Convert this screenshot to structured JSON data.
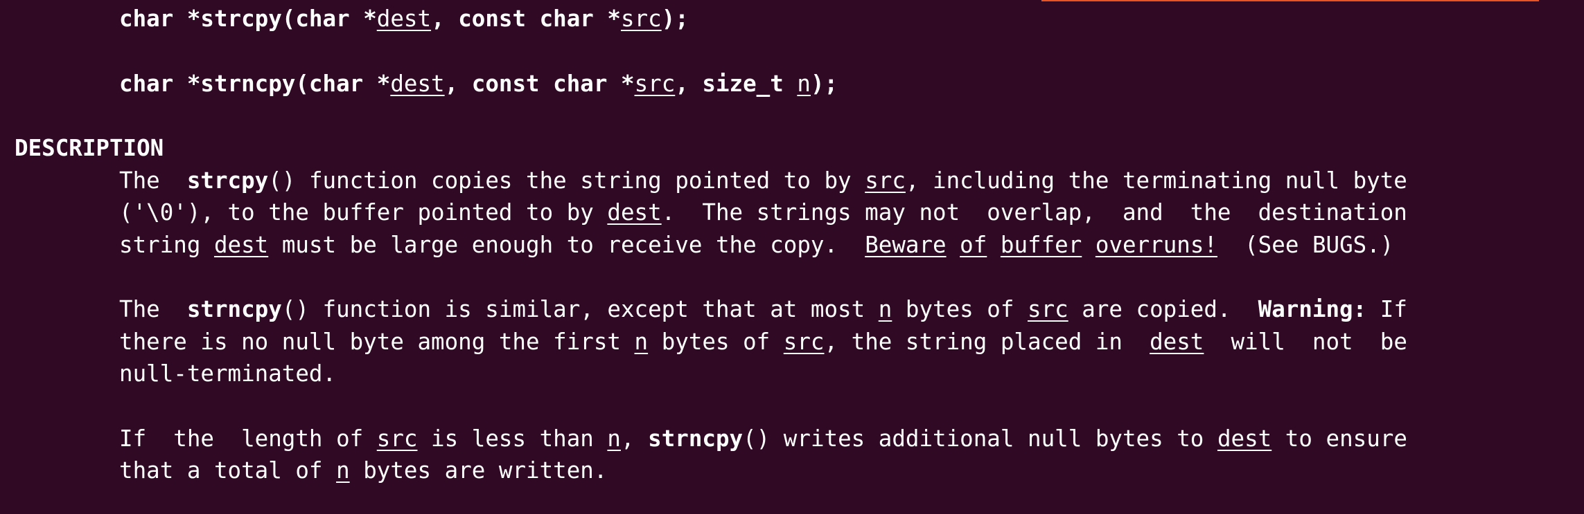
{
  "terminal": {
    "accent_color": "#e95420",
    "background_color": "#300a24",
    "text_color": "#ffffff"
  },
  "synopsis": {
    "line1": {
      "part1": "char *strcpy(char *",
      "dest": "dest",
      "part2": ", const char *",
      "src": "src",
      "part3": ");"
    },
    "line2": {
      "part1": "char *strncpy(char *",
      "dest": "dest",
      "part2": ", const char *",
      "src": "src",
      "part3": ", size_t ",
      "n": "n",
      "part4": ");"
    }
  },
  "description": {
    "heading": "DESCRIPTION",
    "p1": {
      "l1_a": "The  ",
      "l1_fn": "strcpy",
      "l1_b": "() function copies the string pointed to by ",
      "l1_src": "src",
      "l1_c": ", including the terminating null byte",
      "l2_a": "('\\0'), to the buffer pointed to by ",
      "l2_dest": "dest",
      "l2_b": ".  The strings may not  overlap,  and  the  destination",
      "l3_a": "string ",
      "l3_dest": "dest",
      "l3_b": " must be large enough to receive the copy.  ",
      "l3_w1": "Beware",
      "l3_s1": " ",
      "l3_w2": "of",
      "l3_s2": " ",
      "l3_w3": "buffer",
      "l3_s3": " ",
      "l3_w4": "overruns!",
      "l3_c": "  (See BUGS.)"
    },
    "p2": {
      "l1_a": "The  ",
      "l1_fn": "strncpy",
      "l1_b": "() function is similar, except that at most ",
      "l1_n": "n",
      "l1_c": " bytes of ",
      "l1_src": "src",
      "l1_d": " are copied.  ",
      "l1_warn": "Warning:",
      "l1_e": " If",
      "l2_a": "there is no null byte among the first ",
      "l2_n": "n",
      "l2_b": " bytes of ",
      "l2_src": "src",
      "l2_c": ", the string placed in  ",
      "l2_dest": "dest",
      "l2_d": "  will  not  be",
      "l3": "null-terminated."
    },
    "p3": {
      "l1_a": "If  the  length of ",
      "l1_src": "src",
      "l1_b": " is less than ",
      "l1_n": "n",
      "l1_c": ", ",
      "l1_fn": "strncpy",
      "l1_d": "() writes additional null bytes to ",
      "l1_dest": "dest",
      "l1_e": " to ensure",
      "l2_a": "that a total of ",
      "l2_n": "n",
      "l2_b": " bytes are written."
    }
  }
}
